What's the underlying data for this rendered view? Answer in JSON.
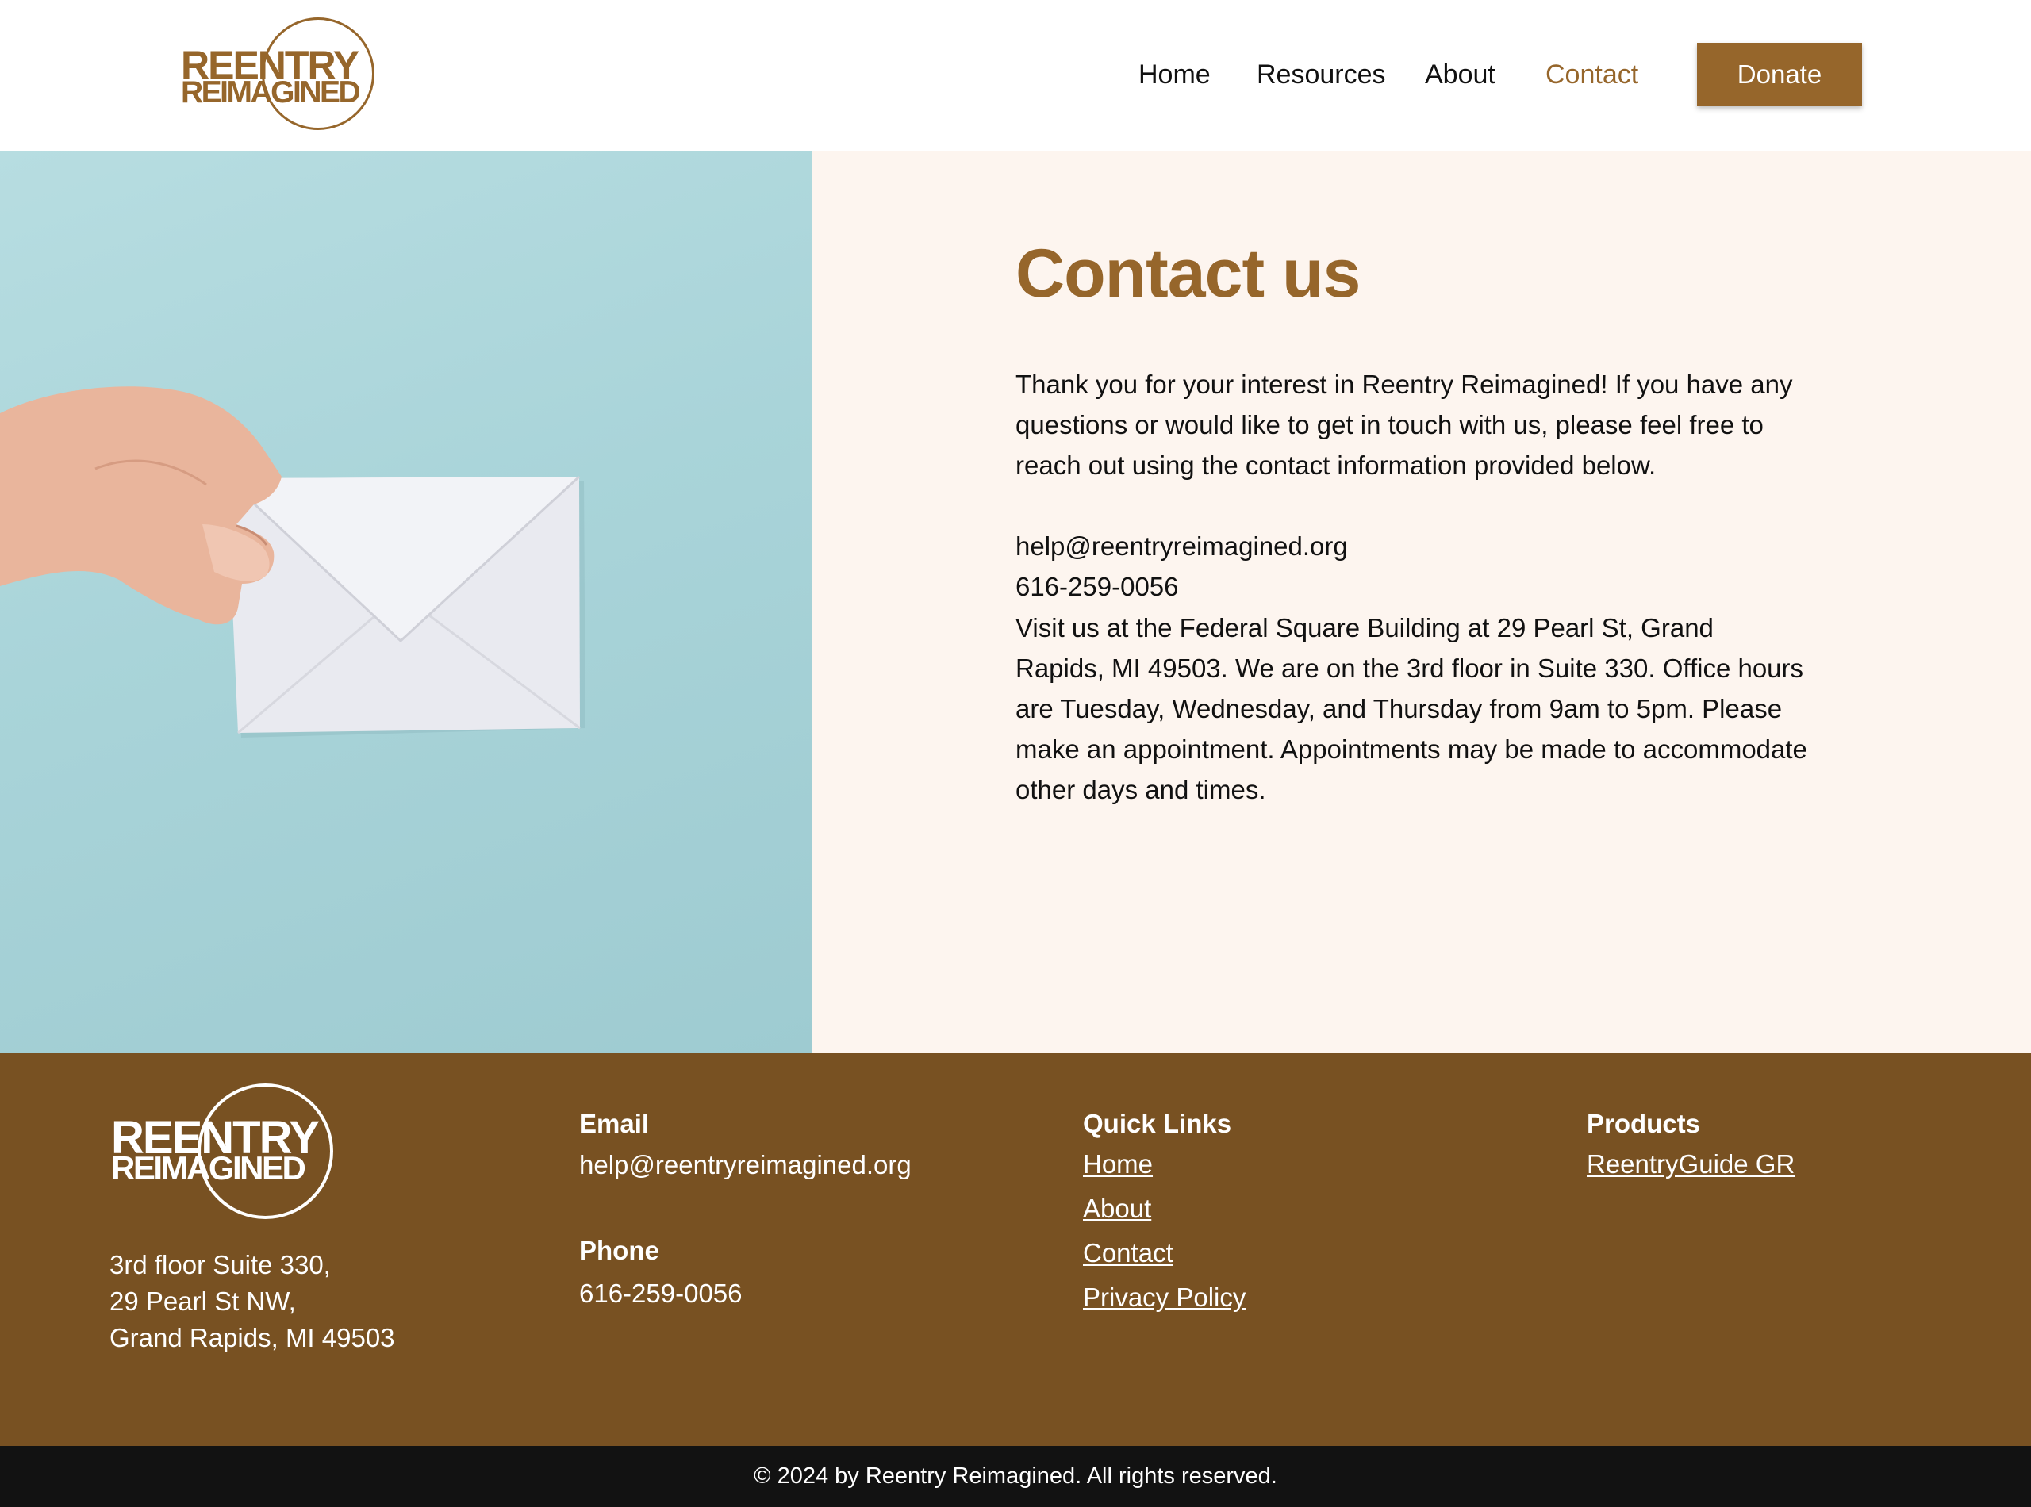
{
  "brand": {
    "logo_line1": "REENTRY",
    "logo_line2": "REIMAGINED",
    "color_primary": "#96662b",
    "color_footer": "#785122",
    "color_bottom_bar": "#121212",
    "color_content_bg": "#fdf5ef"
  },
  "nav": {
    "items": [
      {
        "label": "Home",
        "active": false
      },
      {
        "label": "Resources",
        "active": false
      },
      {
        "label": "About",
        "active": false
      },
      {
        "label": "Contact",
        "active": true
      }
    ],
    "donate_label": "Donate"
  },
  "hero": {
    "image_icon": "hand-holding-envelope-photo",
    "title": "Contact us",
    "intro": "Thank you for your interest in Reentry Reimagined! If you have any questions or would like to get in touch with us, please feel free to reach out using the contact information provided below.",
    "email": "help@reentryreimagined.org",
    "phone": "616-259-0056",
    "visit": "Visit us at the Federal Square Building at 29 Pearl St, Grand Rapids, MI 49503. We are on the 3rd floor in Suite 330. Office hours are Tuesday, Wednesday, and Thursday from 9am to 5pm. Please make an appointment. Appointments may be made to accommodate other days and times."
  },
  "footer": {
    "address": [
      "3rd floor Suite 330,",
      "29 Pearl St NW,",
      "Grand Rapids, MI 49503"
    ],
    "email_heading": "Email",
    "email": "help@reentryreimagined.org",
    "phone_heading": "Phone",
    "phone": "616-259-0056",
    "quick_links_heading": "Quick Links",
    "quick_links": [
      "Home",
      "About",
      "Contact",
      "Privacy Policy"
    ],
    "products_heading": "Products",
    "products": [
      "ReentryGuide GR"
    ],
    "copyright": "© 2024 by Reentry Reimagined. All rights reserved."
  }
}
